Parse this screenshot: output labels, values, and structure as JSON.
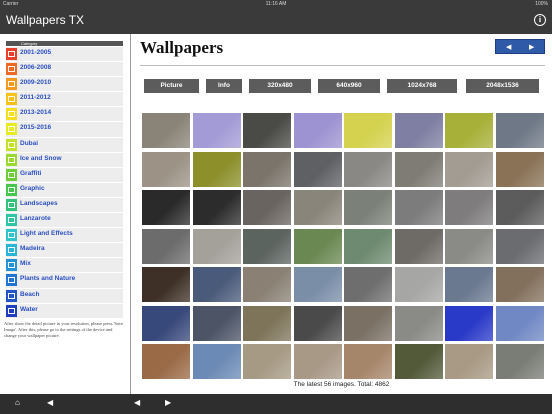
{
  "status": {
    "carrier": "Carrier",
    "time": "11:16 AM",
    "battery": "100%"
  },
  "nav": {
    "title": "Wallpapers TX",
    "info_label": "i"
  },
  "sidebar": {
    "header": "Category",
    "items": [
      {
        "label": "2001-2005",
        "color": "#e8402a"
      },
      {
        "label": "2006-2008",
        "color": "#ee6a26"
      },
      {
        "label": "2009-2010",
        "color": "#f29a20"
      },
      {
        "label": "2011-2012",
        "color": "#f6c21a"
      },
      {
        "label": "2013-2014",
        "color": "#f4e020"
      },
      {
        "label": "2015-2016",
        "color": "#e7ea24"
      },
      {
        "label": "Dubai",
        "color": "#c4e22c"
      },
      {
        "label": "Ice and Snow",
        "color": "#9bd832"
      },
      {
        "label": "Graffiti",
        "color": "#6ccf3a"
      },
      {
        "label": "Graphic",
        "color": "#47c74e"
      },
      {
        "label": "Landscapes",
        "color": "#34c37a"
      },
      {
        "label": "Lanzarote",
        "color": "#2fc4a6"
      },
      {
        "label": "Light and Effects",
        "color": "#2fc6cc"
      },
      {
        "label": "Madeira",
        "color": "#2ab4d8"
      },
      {
        "label": "Mix",
        "color": "#2593d8"
      },
      {
        "label": "Plants and Nature",
        "color": "#2274d4"
      },
      {
        "label": "Beach",
        "color": "#2255c8"
      },
      {
        "label": "Water",
        "color": "#1f3fbc"
      }
    ],
    "note": "After show the detail picture in your resolution, please press 'Save Image'. After this, please go to the settings of the device and change your wallpaper picture."
  },
  "main": {
    "title": "Wallpapers",
    "pager": {
      "prev": "◀",
      "next": "▶"
    },
    "buttons": [
      "Picture",
      "Info",
      "320x480",
      "640x960",
      "1024x768",
      "2048x1536"
    ],
    "footer": "The latest 56 images. Total: 4862",
    "thumbs": [
      [
        "#8a8478",
        "#a39bd6",
        "#4a4a46",
        "#9d93d2",
        "#d4d24e",
        "#7e7fa2",
        "#a7b038",
        "#6e7886"
      ],
      [
        "#9c9286",
        "#8c8f2a",
        "#7a746a",
        "#5f6064",
        "#8a8884",
        "#7e7c74",
        "#a29c92",
        "#8a7256"
      ],
      [
        "#2a2a2a",
        "#2c2c2c",
        "#6a6460",
        "#8a857a",
        "#7b8078",
        "#7c7c7c",
        "#7e7c7c",
        "#5c5c5c"
      ],
      [
        "#6c6c6c",
        "#a4a09a",
        "#5c6460",
        "#6a8852",
        "#6e8a70",
        "#6e6a66",
        "#8a8a86",
        "#6a6c70"
      ],
      [
        "#3e3026",
        "#4a5a7a",
        "#8a8174",
        "#7a8ea8",
        "#6e6e6e",
        "#a6a6a4",
        "#6a7890",
        "#82705c"
      ],
      [
        "#37487a",
        "#4c5466",
        "#7e745a",
        "#4a4a4a",
        "#7a7064",
        "#8a8a86",
        "#2a3ac8",
        "#7088c4"
      ],
      [
        "#9a6a46",
        "#6c8ab6",
        "#a69a84",
        "#a89886",
        "#a6866a",
        "#525a3a",
        "#a89a84",
        "#7a7c76"
      ]
    ]
  }
}
